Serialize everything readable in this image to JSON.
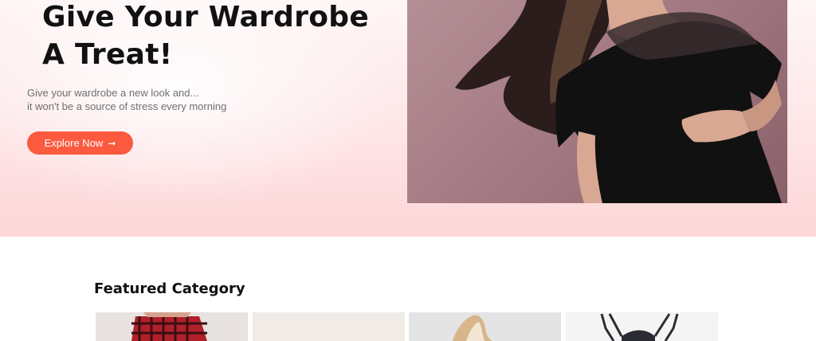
{
  "hero": {
    "title_line1": "Give Your Wardrobe",
    "title_line2": "A Treat!",
    "subtitle_line1": "Give your wardrobe a new look and...",
    "subtitle_line2": "it won't be a source of stress every morning",
    "cta_label": "Explore Now",
    "cta_icon": "arrow-right-icon",
    "accent_color": "#fb5a3f"
  },
  "featured": {
    "title": "Featured Category"
  }
}
